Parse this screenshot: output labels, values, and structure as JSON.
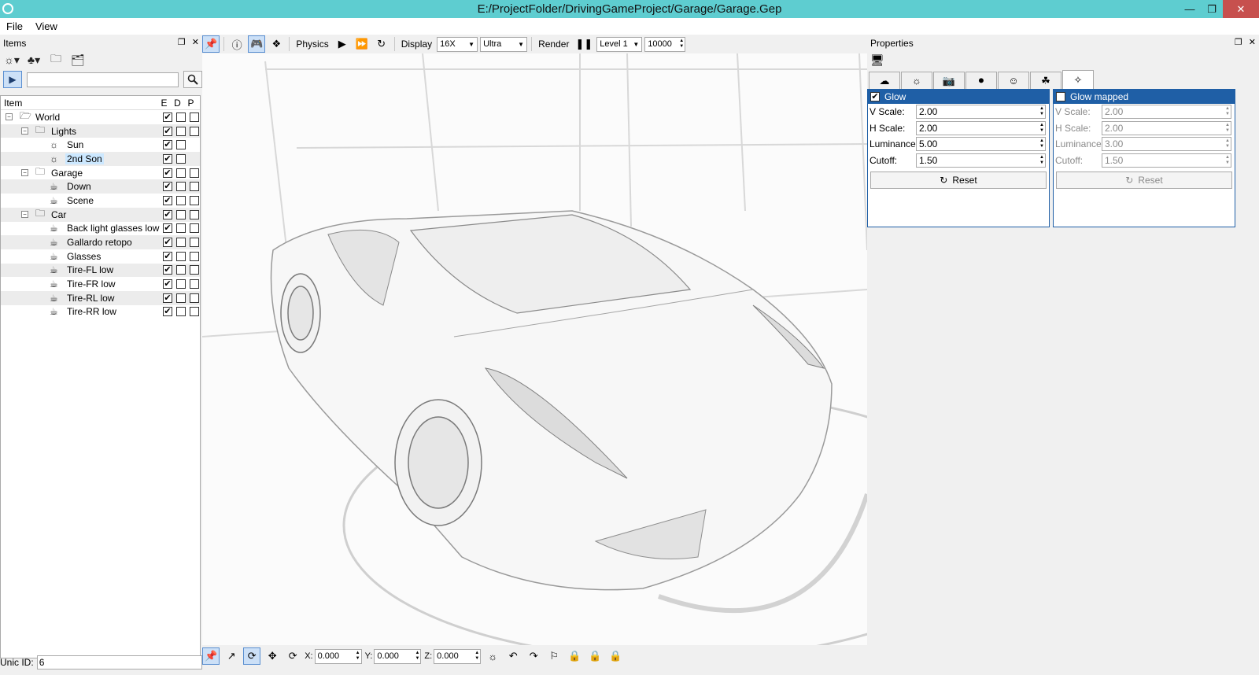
{
  "window": {
    "title": "E:/ProjectFolder/DrivingGameProject/Garage/Garage.Gep"
  },
  "menu": {
    "file": "File",
    "view": "View"
  },
  "items_panel": {
    "title": "Items",
    "tree_header": {
      "item": "Item",
      "e": "E",
      "d": "D",
      "p": "P"
    },
    "rows": [
      {
        "label": "World",
        "depth": 0,
        "icon": "folder-icon",
        "expander": "−",
        "e": true,
        "d": false,
        "p": false
      },
      {
        "label": "Lights",
        "depth": 1,
        "icon": "group-folder-icon",
        "expander": "−",
        "e": true,
        "d": false,
        "p": false
      },
      {
        "label": "Sun",
        "depth": 2,
        "icon": "sun-icon",
        "e": true,
        "d": false
      },
      {
        "label": "2nd Son",
        "depth": 2,
        "icon": "sun-icon",
        "e": true,
        "d": false,
        "selected": true
      },
      {
        "label": "Garage",
        "depth": 1,
        "icon": "group-folder-icon",
        "expander": "−",
        "e": true,
        "d": false,
        "p": false
      },
      {
        "label": "Down",
        "depth": 2,
        "icon": "teapot-icon",
        "e": true,
        "d": false,
        "p": false
      },
      {
        "label": "Scene",
        "depth": 2,
        "icon": "teapot-icon",
        "e": true,
        "d": false,
        "p": false
      },
      {
        "label": "Car",
        "depth": 1,
        "icon": "group-folder-icon",
        "expander": "−",
        "e": true,
        "d": false,
        "p": false
      },
      {
        "label": "Back light glasses low",
        "depth": 2,
        "icon": "teapot-icon",
        "e": true,
        "d": false,
        "p": false
      },
      {
        "label": "Gallardo retopo",
        "depth": 2,
        "icon": "teapot-icon",
        "e": true,
        "d": false,
        "p": false
      },
      {
        "label": "Glasses",
        "depth": 2,
        "icon": "teapot-icon",
        "e": true,
        "d": false,
        "p": false
      },
      {
        "label": "Tire-FL low",
        "depth": 2,
        "icon": "teapot-icon",
        "e": true,
        "d": false,
        "p": false
      },
      {
        "label": "Tire-FR low",
        "depth": 2,
        "icon": "teapot-icon",
        "e": true,
        "d": false,
        "p": false
      },
      {
        "label": "Tire-RL low",
        "depth": 2,
        "icon": "teapot-icon",
        "e": true,
        "d": false,
        "p": false
      },
      {
        "label": "Tire-RR low",
        "depth": 2,
        "icon": "teapot-icon",
        "e": true,
        "d": false,
        "p": false
      }
    ],
    "unic_id_label": "Unic ID:",
    "unic_id_value": "6"
  },
  "toolbar": {
    "physics_label": "Physics",
    "display_label": "Display",
    "display_value": "16X",
    "quality_value": "Ultra",
    "render_label": "Render",
    "level_value": "Level 1",
    "count_value": "10000"
  },
  "bottom_toolbar": {
    "x_label": "X:",
    "x_value": "0.000",
    "y_label": "Y:",
    "y_value": "0.000",
    "z_label": "Z:",
    "z_value": "0.000"
  },
  "properties": {
    "title": "Properties",
    "glow": {
      "title": "Glow",
      "checked": true,
      "v_scale_label": "V Scale:",
      "v_scale": "2.00",
      "h_scale_label": "H Scale:",
      "h_scale": "2.00",
      "luminance_label": "Luminance:",
      "luminance": "5.00",
      "cutoff_label": "Cutoff:",
      "cutoff": "1.50",
      "reset": "Reset"
    },
    "glow_mapped": {
      "title": "Glow mapped",
      "checked": false,
      "v_scale_label": "V Scale:",
      "v_scale": "2.00",
      "h_scale_label": "H Scale:",
      "h_scale": "2.00",
      "luminance_label": "Luminance:",
      "luminance": "3.00",
      "cutoff_label": "Cutoff:",
      "cutoff": "1.50",
      "reset": "Reset"
    }
  },
  "colors": {
    "titlebar": "#5ecdd0",
    "close": "#c7504e",
    "accent": "#1f5fa6",
    "selection": "#cce8ff"
  }
}
